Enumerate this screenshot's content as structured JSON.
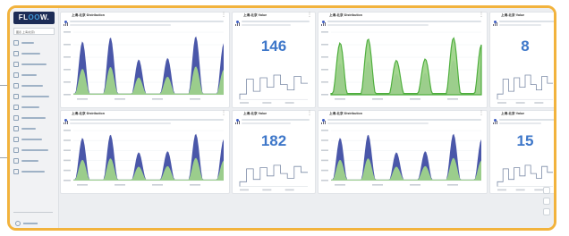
{
  "app": {
    "logo_text": "FL",
    "logo_text_b": "W.",
    "brand_color": "#1d2c56",
    "frame_color": "#f2b33d"
  },
  "sidebar": {
    "selector_label": "图表 上海(北京)",
    "items": [
      {
        "icon": "dashboard-icon"
      },
      {
        "icon": "list-icon"
      },
      {
        "icon": "search-icon"
      },
      {
        "icon": "flow-icon"
      },
      {
        "icon": "chart-icon"
      },
      {
        "icon": "settings-icon"
      },
      {
        "icon": "users-icon"
      },
      {
        "icon": "grid-icon"
      },
      {
        "icon": "data-icon"
      },
      {
        "icon": "bell-icon"
      },
      {
        "icon": "report-icon"
      },
      {
        "icon": "layers-icon"
      },
      {
        "icon": "folder-icon"
      }
    ]
  },
  "panels": [
    {
      "title": "上海-北京·Distribution",
      "type": "distribution"
    },
    {
      "title": "上海-北京·Value",
      "type": "value",
      "value": "146"
    },
    {
      "title": "上海-北京·Distribution",
      "type": "distribution"
    },
    {
      "title": "上海-北京·Value",
      "type": "value",
      "value": "8"
    },
    {
      "title": "上海-北京·Distribution",
      "type": "distribution"
    },
    {
      "title": "上海-北京·Value",
      "type": "value",
      "value": "182"
    },
    {
      "title": "上海-北京·Distribution",
      "type": "distribution"
    },
    {
      "title": "上海-北京·Value",
      "type": "value",
      "value": "15"
    }
  ],
  "colors": {
    "series_blue": "#4a57a9",
    "series_green": "#9fd48a",
    "series_green_dark": "#4fae3e",
    "number": "#3e77c9",
    "step_line": "#7b8aa6"
  }
}
